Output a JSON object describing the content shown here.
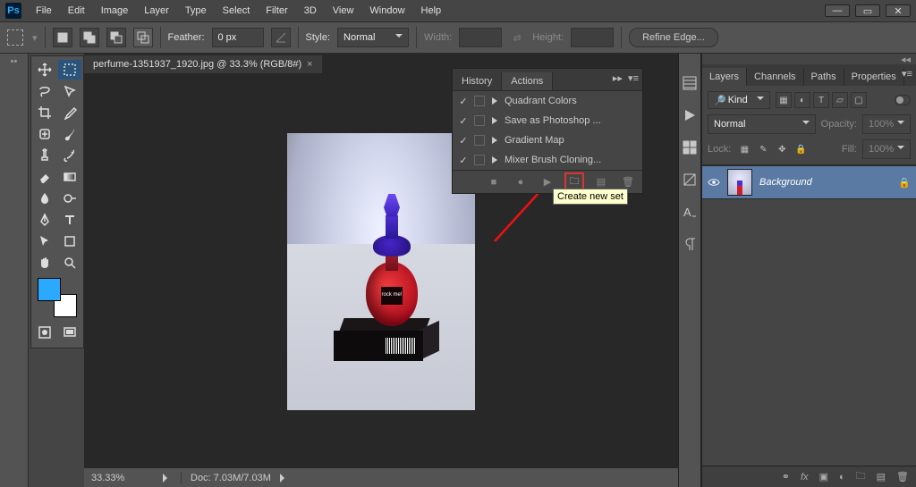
{
  "menubar": {
    "items": [
      "File",
      "Edit",
      "Image",
      "Layer",
      "Type",
      "Select",
      "Filter",
      "3D",
      "View",
      "Window",
      "Help"
    ]
  },
  "optionsbar": {
    "feather_label": "Feather:",
    "feather_value": "0 px",
    "style_label": "Style:",
    "style_value": "Normal",
    "width_label": "Width:",
    "height_label": "Height:",
    "refine_label": "Refine Edge..."
  },
  "document": {
    "tab_title": "perfume-1351937_1920.jpg @ 33.3% (RGB/8#)"
  },
  "status": {
    "zoom": "33.33%",
    "doc": "Doc: 7.03M/7.03M"
  },
  "actions_panel": {
    "tabs": [
      "History",
      "Actions"
    ],
    "items": [
      "Quadrant Colors",
      "Save as Photoshop ...",
      "Gradient Map",
      "Mixer Brush Cloning..."
    ],
    "tooltip": "Create new set"
  },
  "layers_panel": {
    "tabs": [
      "Layers",
      "Channels",
      "Paths",
      "Properties"
    ],
    "kind_label": "Kind",
    "blend_mode": "Normal",
    "opacity_label": "Opacity:",
    "opacity_value": "100%",
    "lock_label": "Lock:",
    "fill_label": "Fill:",
    "fill_value": "100%",
    "layer_name": "Background",
    "search_placeholder": "Kind"
  },
  "bottle_label": "rock me!"
}
